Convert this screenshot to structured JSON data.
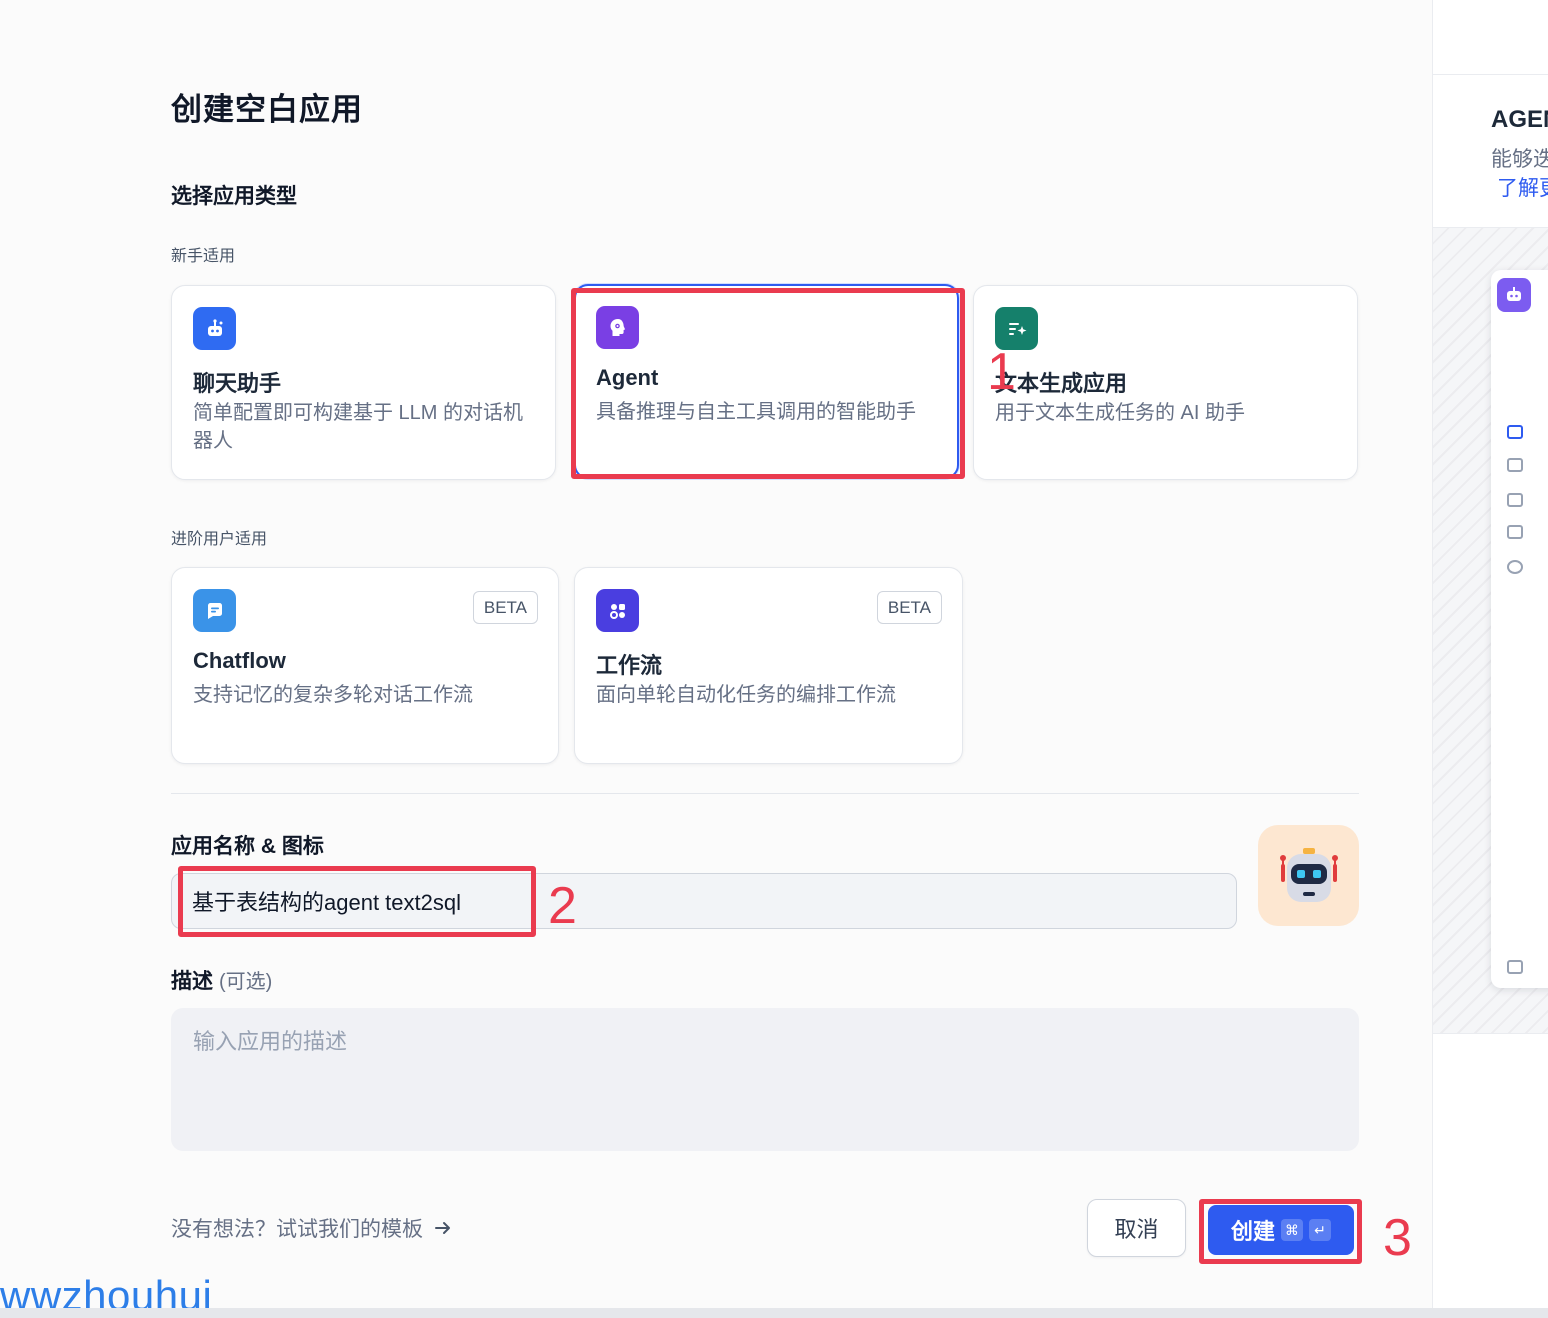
{
  "dialog": {
    "title": "创建空白应用",
    "type_section_title": "选择应用类型",
    "groups": {
      "beginner": "新手适用",
      "advanced": "进阶用户适用"
    },
    "cards": {
      "chat": {
        "title": "聊天助手",
        "desc": "简单配置即可构建基于 LLM 的对话机器人",
        "icon": "chat-bot-icon",
        "color": "#2f6bf2"
      },
      "agent": {
        "title": "Agent",
        "desc": "具备推理与自主工具调用的智能助手",
        "icon": "agent-brain-icon",
        "color": "#7a3fe4",
        "selected": true
      },
      "completion": {
        "title": "文本生成应用",
        "desc": "用于文本生成任务的 AI 助手",
        "icon": "text-generate-icon",
        "color": "#15806b"
      },
      "chatflow": {
        "title": "Chatflow",
        "desc": "支持记忆的复杂多轮对话工作流",
        "badge": "BETA",
        "icon": "chatflow-icon",
        "color": "#3a93e8"
      },
      "workflow": {
        "title": "工作流",
        "desc": "面向单轮自动化任务的编排工作流",
        "badge": "BETA",
        "icon": "workflow-icon",
        "color": "#4a3ee0"
      }
    },
    "name_section": {
      "label": "应用名称 & 图标",
      "value": "基于表结构的agent text2sql",
      "avatar": "robot-avatar-icon",
      "avatar_bg": "#fde7d1"
    },
    "desc_section": {
      "label": "描述",
      "optional": "(可选)",
      "placeholder": "输入应用的描述"
    },
    "footer": {
      "template_link": "没有想法？试试我们的模板",
      "cancel": "取消",
      "create": "创建",
      "shortcut_cmd": "⌘",
      "shortcut_enter": "↵"
    }
  },
  "annotations": [
    "1",
    "2",
    "3"
  ],
  "watermark": "wwzhouhui",
  "right_panel": {
    "title": "AGENT",
    "desc": "能够迭",
    "link": "了解更"
  },
  "colors": {
    "primary": "#2e5bf0",
    "annotation": "#ea3b4f"
  }
}
